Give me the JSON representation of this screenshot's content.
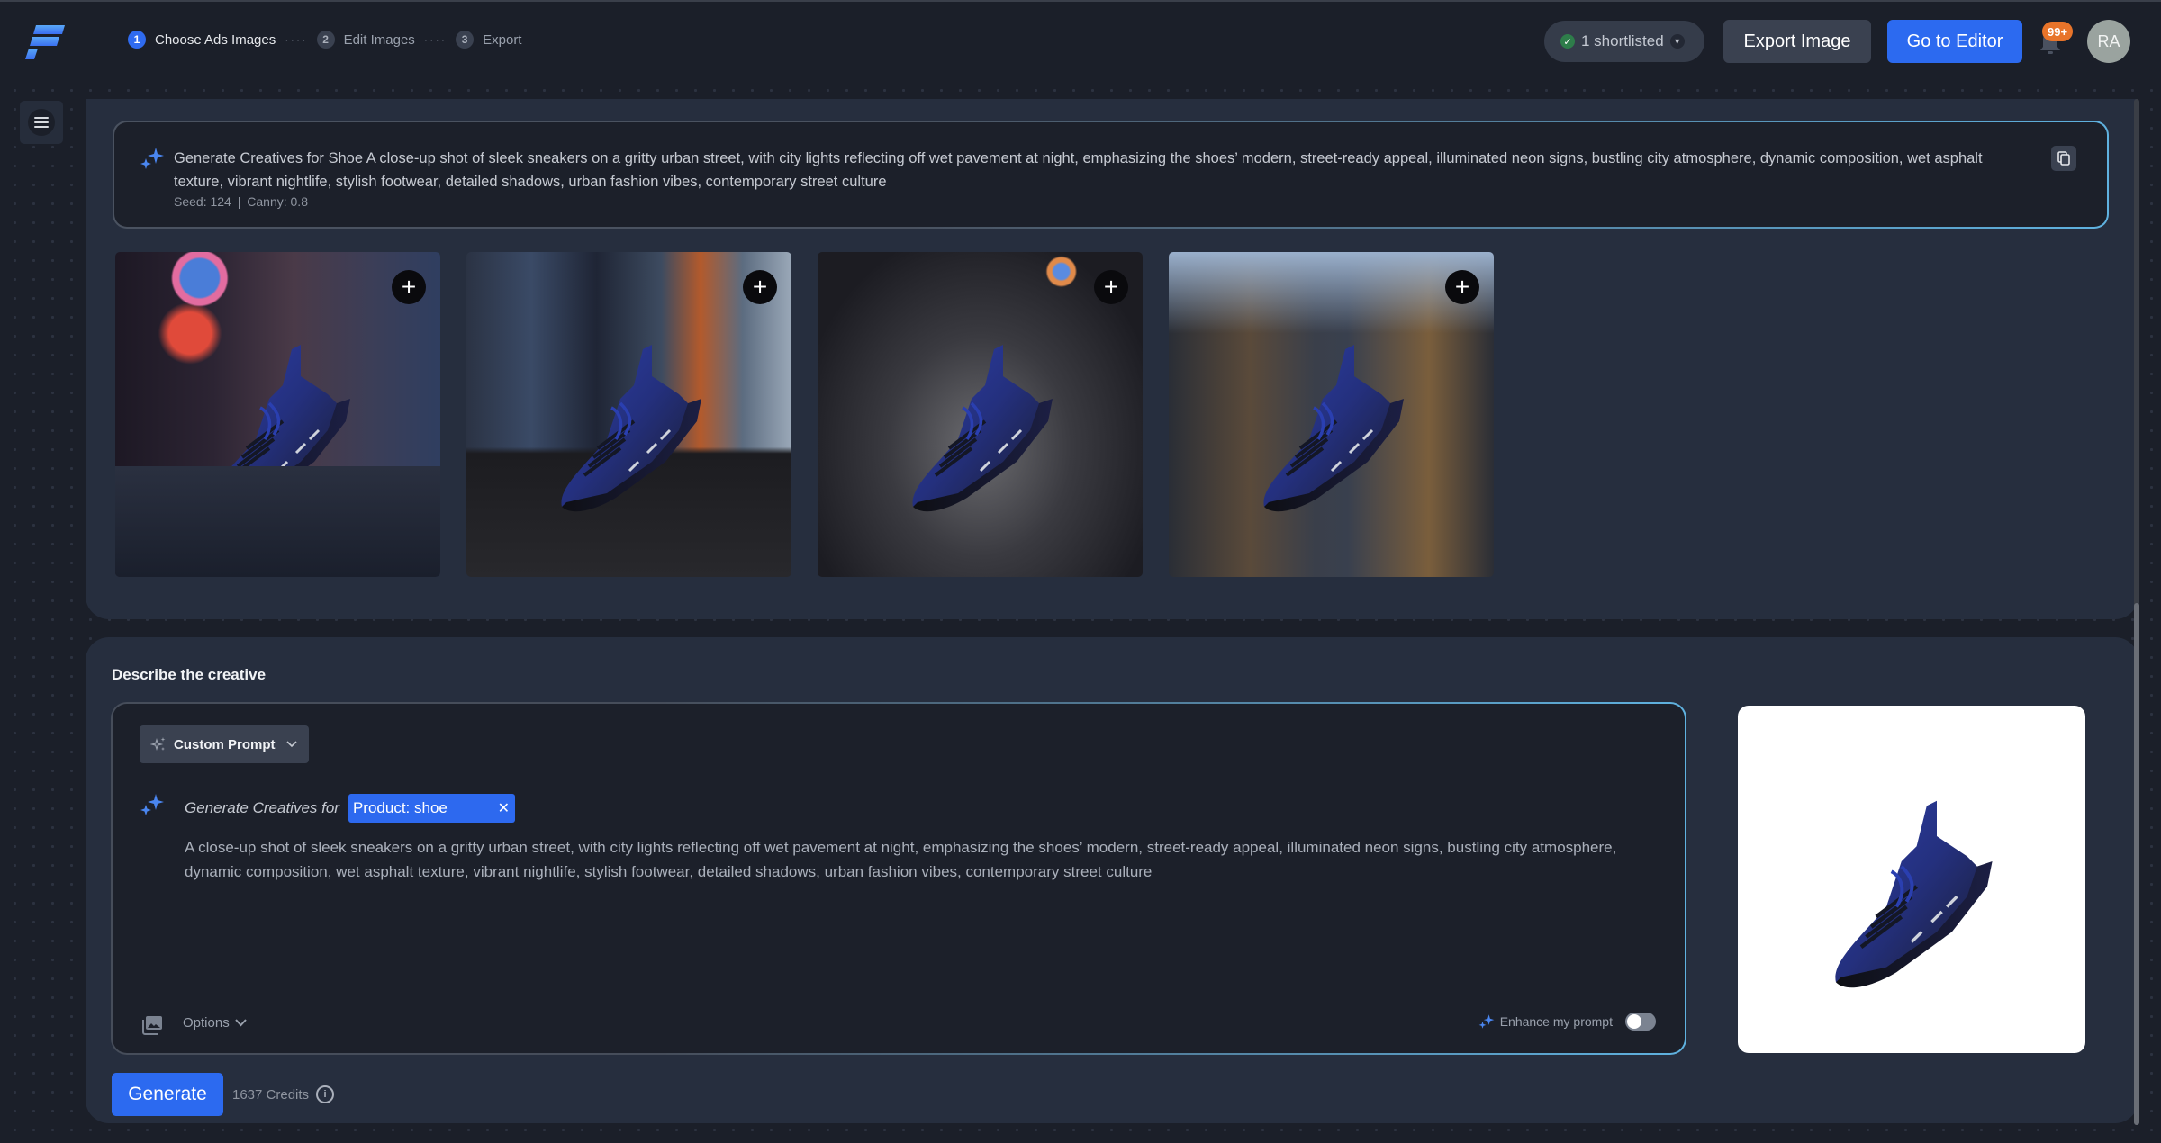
{
  "header": {
    "logo": "pixelbin-logo",
    "steps": [
      {
        "num": "1",
        "label": "Choose Ads Images",
        "active": true
      },
      {
        "num": "2",
        "label": "Edit Images",
        "active": false
      },
      {
        "num": "3",
        "label": "Export",
        "active": false
      }
    ],
    "step_separator": "····",
    "shortlisted_label": "1 shortlisted",
    "export_button": "Export Image",
    "editor_button": "Go to Editor",
    "notification_badge": "99+",
    "avatar_initials": "RA",
    "colors": {
      "accent": "#2c6af0",
      "badge": "#e8742a",
      "avatar": "#9aa39f"
    }
  },
  "history": {
    "prompt": "Generate Creatives for Shoe A close-up shot of sleek sneakers on a gritty urban street, with city lights reflecting off wet pavement at night, emphasizing the shoes’ modern, street-ready appeal, illuminated neon signs, bustling city atmosphere, dynamic composition, wet asphalt texture, vibrant nightlife, stylish footwear, detailed shadows, urban fashion vibes, contemporary street culture",
    "seed_label": "Seed: 124",
    "canny_label": "Canny: 0.8",
    "meta_separator": "|",
    "images": [
      {
        "alt": "Blue sneaker in neon-lit alley at night",
        "add_label": "+"
      },
      {
        "alt": "Blue sneaker on city sidewalk with storefront signs",
        "add_label": "+"
      },
      {
        "alt": "Blue sneaker on wet asphalt road at night",
        "add_label": "+"
      },
      {
        "alt": "Blue sneaker in narrow street with puddle reflections",
        "add_label": "+"
      }
    ]
  },
  "composer": {
    "title": "Describe the creative",
    "preset_label": "Custom Prompt",
    "generate_for_label": "Generate Creatives for",
    "product_chip": "Product: shoe",
    "chip_remove": "✕",
    "description": "A close-up shot of sleek sneakers on a gritty urban street, with city lights reflecting off wet pavement at night, emphasizing the shoes’ modern, street-ready appeal, illuminated neon signs, bustling city atmosphere, dynamic composition, wet asphalt texture, vibrant nightlife, stylish footwear, detailed shadows, urban fashion vibes, contemporary street culture",
    "options_label": "Options",
    "enhance_label": "Enhance my prompt",
    "enhance_enabled": false,
    "reference_image_alt": "Blue sneaker product photo on white background",
    "generate_button": "Generate",
    "credits_label": "1637 Credits",
    "info_symbol": "i"
  }
}
